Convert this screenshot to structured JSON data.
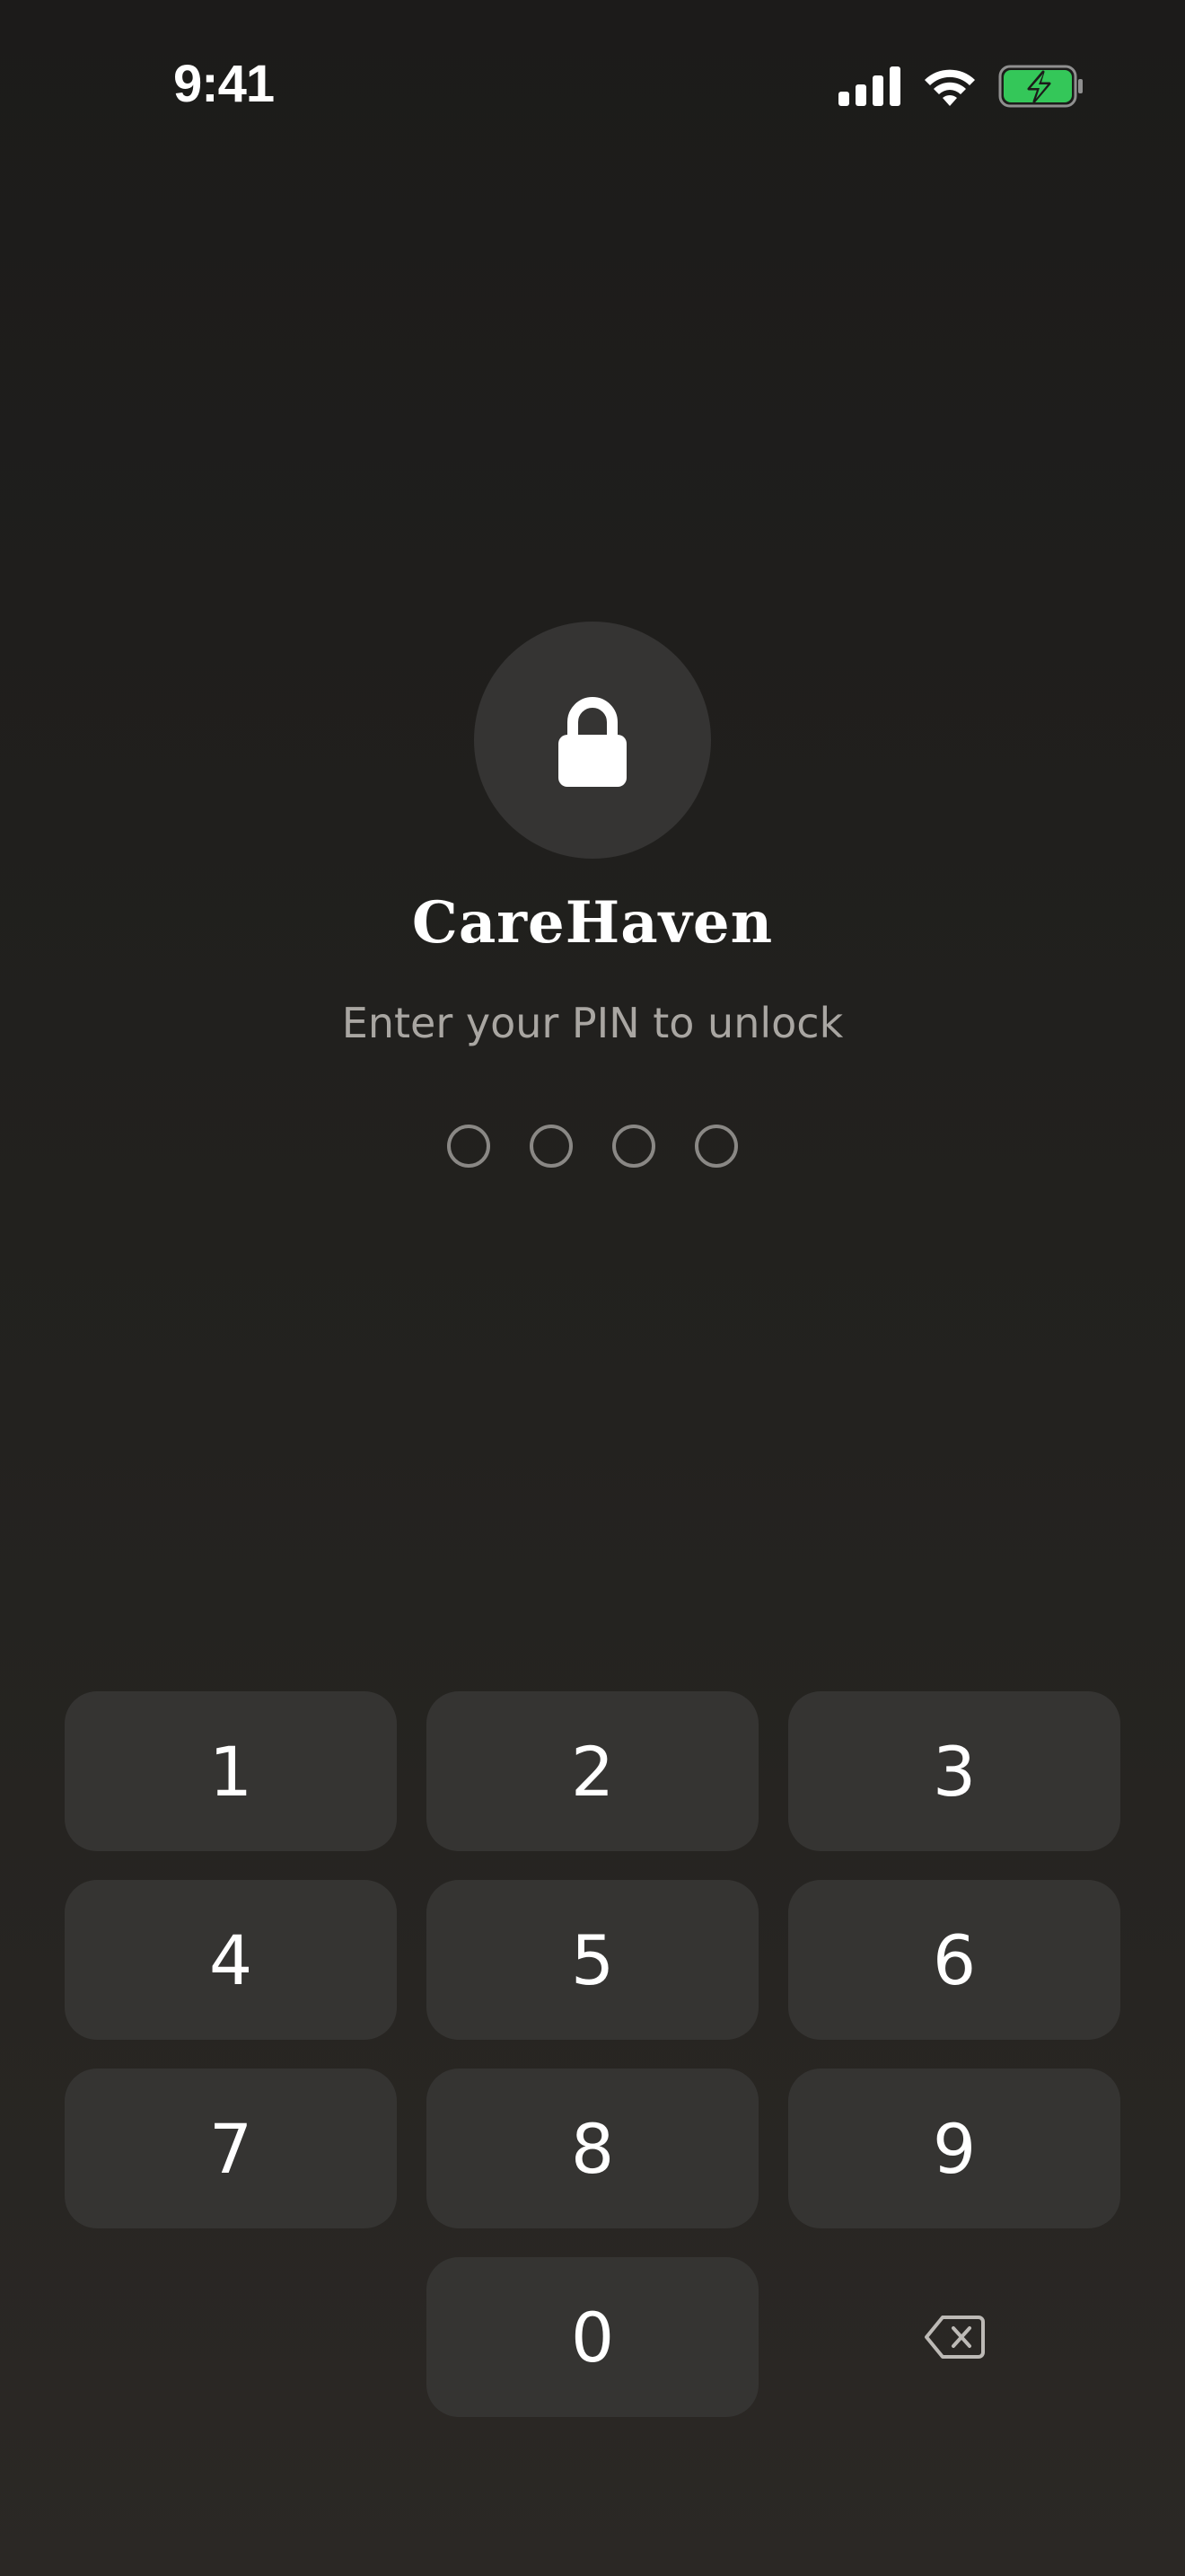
{
  "status_bar": {
    "time": "9:41",
    "icons": [
      "cellular-signal-icon",
      "wifi-icon",
      "battery-charging-icon"
    ],
    "battery_color": "#34c759"
  },
  "lock_screen": {
    "icon": "lock-icon",
    "app_name": "CareHaven",
    "prompt": "Enter your PIN to unlock",
    "pin_length": 4,
    "pin_entered": 0
  },
  "keypad": {
    "keys": [
      "1",
      "2",
      "3",
      "4",
      "5",
      "6",
      "7",
      "8",
      "9",
      "0"
    ],
    "backspace_icon": "backspace-icon"
  },
  "colors": {
    "background": "#1c1b1a",
    "key_background": "#353432",
    "subtitle": "#a9a6a2",
    "dot_border": "#8a8885"
  }
}
